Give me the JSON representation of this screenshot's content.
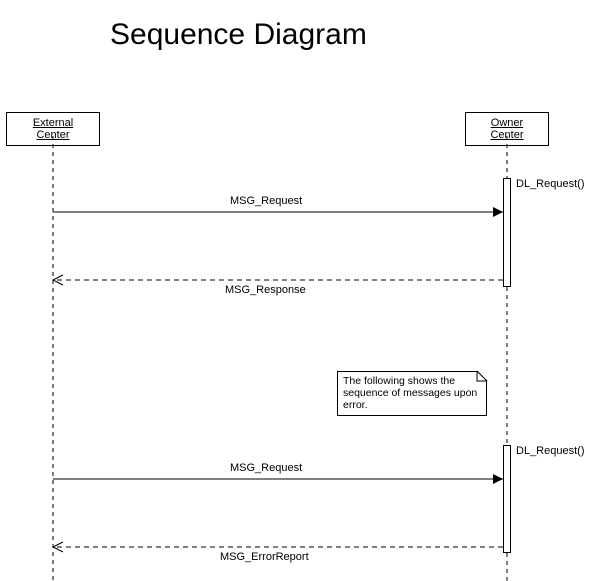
{
  "title": "Sequence Diagram",
  "participants": {
    "external": "External Center",
    "owner": "Owner Center"
  },
  "messages": {
    "req1": "MSG_Request",
    "resp1": "MSG_Response",
    "req2": "MSG_Request",
    "err": "MSG_ErrorReport"
  },
  "activations": {
    "a1": "DL_Request()",
    "a2": "DL_Request()"
  },
  "note": "The following shows the sequence of messages upon error."
}
